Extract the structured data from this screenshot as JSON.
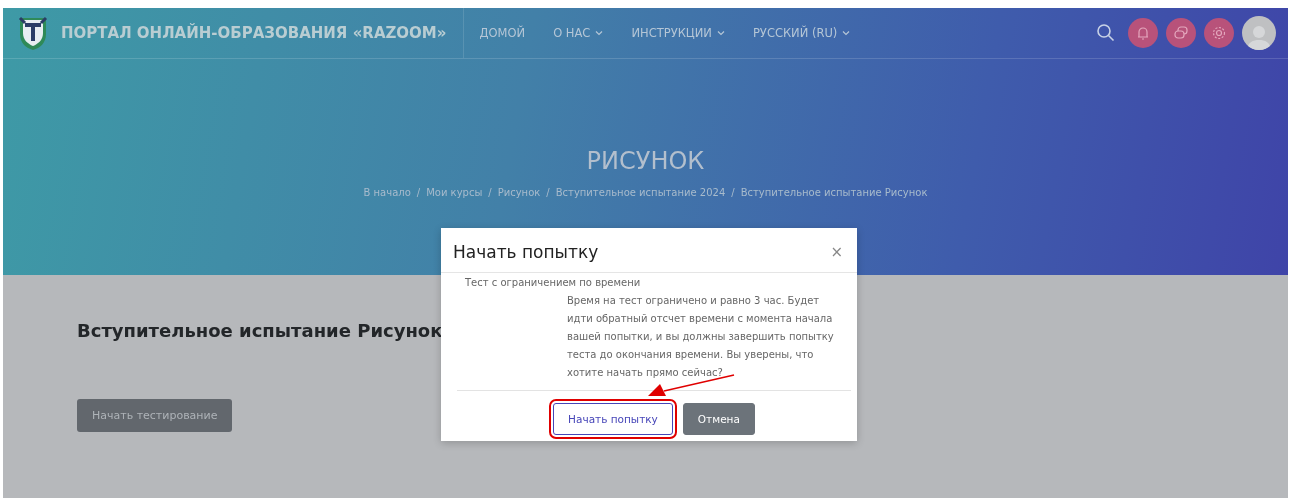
{
  "header": {
    "site_title": "ПОРТАЛ ОНЛАЙН-ОБРАЗОВАНИЯ «RAZOOM»",
    "nav": [
      {
        "label": "ДОМОЙ",
        "dropdown": false
      },
      {
        "label": "О НАС",
        "dropdown": true
      },
      {
        "label": "ИНСТРУКЦИИ",
        "dropdown": true
      },
      {
        "label": "РУССКИЙ (RU)",
        "dropdown": true
      }
    ]
  },
  "hero": {
    "title": "РИСУНОК",
    "separator": "/",
    "breadcrumbs": [
      "В начало",
      "Мои курсы",
      "Рисунок",
      "Вступительное испытание 2024",
      "Вступительное испытание Рисунок"
    ]
  },
  "content": {
    "heading": "Вступительное испытание Рисунок",
    "button": "Начать тестирование"
  },
  "dialog": {
    "title": "Начать попытку",
    "close": "×",
    "section_label": "Тест с ограничением по времени",
    "message": "Время на тест ограничено и равно 3 час. Будет идти обратный отсчет времени с момента начала вашей попытки, и вы должны завершить попытку теста до окончания времени. Вы уверены, что хотите начать прямо сейчас?",
    "buttons": [
      {
        "label": "Начать попытку",
        "kind": "primary",
        "highlighted": true
      },
      {
        "label": "Отмена",
        "kind": "secondary",
        "highlighted": false
      }
    ]
  }
}
